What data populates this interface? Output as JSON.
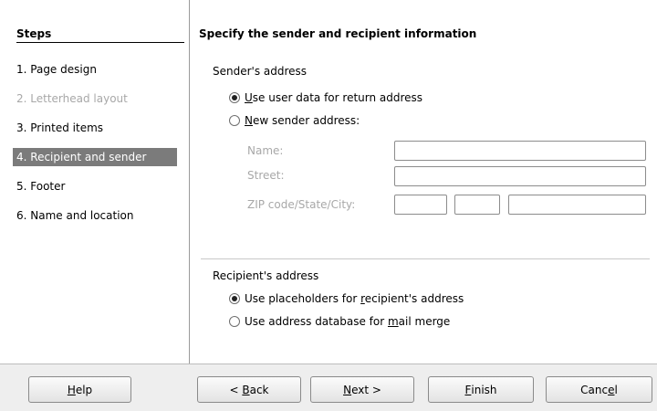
{
  "steps": {
    "header": "Steps",
    "items": [
      {
        "label": "1. Page design",
        "state": "normal"
      },
      {
        "label": "2. Letterhead layout",
        "state": "disabled"
      },
      {
        "label": "3. Printed items",
        "state": "normal"
      },
      {
        "label": "4. Recipient and sender",
        "state": "active"
      },
      {
        "label": "5. Footer",
        "state": "normal"
      },
      {
        "label": "6. Name and location",
        "state": "normal"
      }
    ]
  },
  "main": {
    "title": "Specify the sender and recipient information",
    "sender": {
      "label": "Sender's address",
      "option1": {
        "mnemonic": "U",
        "rest": "se user data for return address",
        "selected": true
      },
      "option2": {
        "mnemonic": "N",
        "rest": "ew sender address:",
        "selected": false
      },
      "name_label": "Name:",
      "name_value": "",
      "street_label": "Street:",
      "street_value": "",
      "zip_label": "ZIP code/State/City:",
      "zip_value": "",
      "state_value": "",
      "city_value": ""
    },
    "recipient": {
      "label": "Recipient's address",
      "option1": {
        "before": "Use placeholders for ",
        "mnemonic": "r",
        "after": "ecipient's address",
        "selected": true
      },
      "option2": {
        "before": "Use address database for ",
        "mnemonic": "m",
        "after": "ail merge",
        "selected": false
      }
    }
  },
  "buttons": {
    "help": {
      "mnemonic": "H",
      "rest": "elp"
    },
    "back": {
      "prefix": "< ",
      "mnemonic": "B",
      "rest": "ack"
    },
    "next": {
      "mnemonic": "N",
      "rest": "ext >"
    },
    "finish": {
      "mnemonic": "F",
      "rest": "inish"
    },
    "cancel": {
      "prefix": "Canc",
      "mnemonic": "e",
      "rest": "l"
    }
  },
  "colors": {
    "active_step_bg": "#7b7b7b",
    "disabled_text": "#a8a8a8",
    "button_bar_bg": "#eeeeee"
  }
}
